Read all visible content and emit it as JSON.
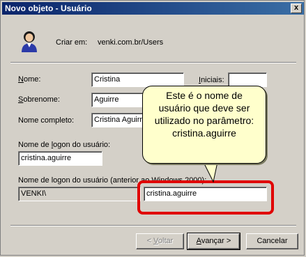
{
  "window": {
    "title": "Novo objeto - Usuário",
    "close_glyph": "x"
  },
  "header": {
    "created_in_label": "Criar em:",
    "created_in_value": "venki.com.br/Users",
    "icon": "user-icon"
  },
  "form": {
    "first_name": {
      "label_underlined": "N",
      "label_rest": "ome:",
      "value": "Cristina"
    },
    "initials": {
      "label_underlined": "I",
      "label_rest": "niciais:",
      "value": ""
    },
    "last_name": {
      "label_underlined": "S",
      "label_rest": "obrenome:",
      "value": "Aguirre"
    },
    "full_name": {
      "label_underlined": "",
      "label_rest": "Nome completo:",
      "value": "Cristina Aguirre"
    },
    "logon_name": {
      "label_before": "Nome de ",
      "label_underlined": "l",
      "label_rest": "ogon do usuário:",
      "value": "cristina.aguirre"
    },
    "pre2000": {
      "label": "Nome de logon do usuário (anterior ao Windows 2000):",
      "domain_value": "VENKI\\",
      "value": "cristina.aguirre"
    }
  },
  "callout": {
    "lines": [
      "Este é o nome de",
      "usuário que deve ser",
      "utilizado no parâmetro:",
      "cristina.aguirre"
    ]
  },
  "buttons": {
    "back": {
      "prefix": "< ",
      "underlined": "V",
      "rest": "oltar"
    },
    "next": {
      "underlined": "A",
      "rest": "vançar >"
    },
    "cancel": {
      "label": "Cancelar"
    }
  },
  "colors": {
    "highlight": "#e00000",
    "callout_bg": "#ffffcc",
    "titlebar": "#0a246a"
  }
}
